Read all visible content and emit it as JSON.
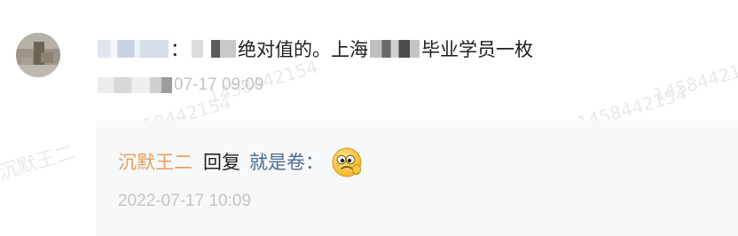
{
  "watermark": {
    "text1": "沉默王二",
    "text2": "1458442154"
  },
  "comment": {
    "middle_text": "绝对值的。上海",
    "tail_text": "毕业学员一枚",
    "time_suffix": "07-17 09:09"
  },
  "reply": {
    "author": "沉默王二",
    "action": "回复",
    "text": "就是卷：",
    "emoji": "awkward-emoji-icon",
    "time": "2022-07-17 10:09"
  },
  "colors": {
    "author_orange": "#e3a05e",
    "reply_blue": "#4c6b92",
    "meta_gray": "#c4c4c4",
    "reply_bg": "#f7f8fa"
  }
}
